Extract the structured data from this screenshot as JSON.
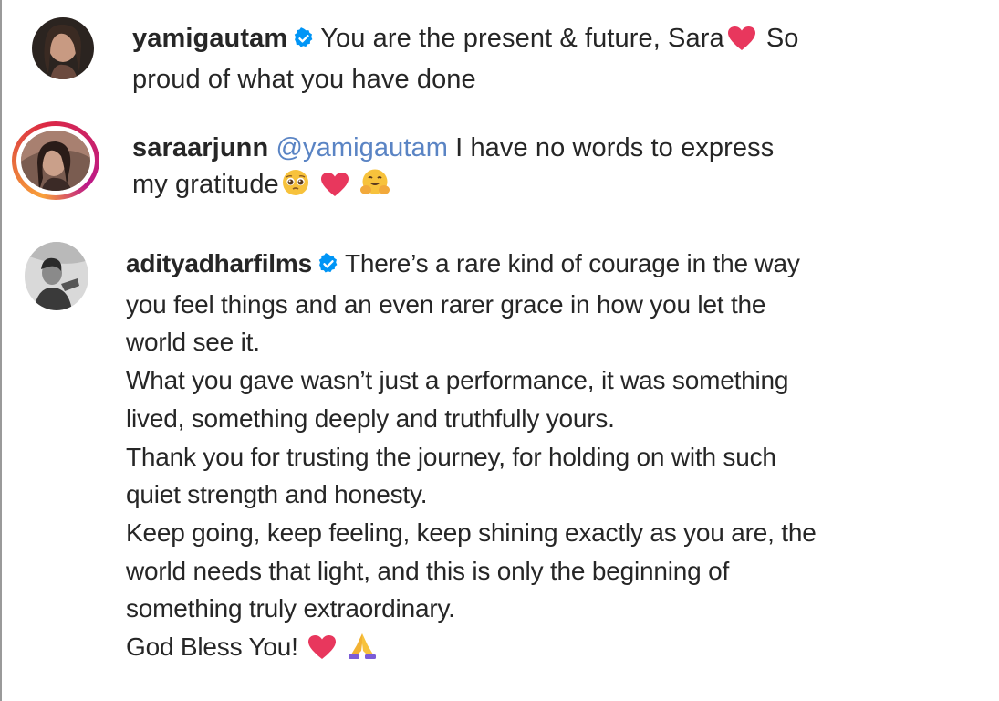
{
  "comments": [
    {
      "username": "yamigautam",
      "verified": true,
      "lines": [
        "You are the present & future, Sara",
        "So",
        "proud of what you have done"
      ],
      "emoji": [
        "red-heart"
      ]
    },
    {
      "username": "saraarjunn",
      "verified": false,
      "has_story_ring": true,
      "mention": "@yamigautam",
      "lines": [
        "I have no words to express",
        "my gratitude"
      ],
      "emoji": [
        "pleading-face",
        "red-heart",
        "hugging-face"
      ]
    },
    {
      "username": "adityadharfilms",
      "verified": true,
      "lines": [
        "There’s a rare kind of courage in the way",
        "you feel things and an even rarer grace in how you let the",
        "world see it.",
        "What you gave wasn’t just a performance, it was something",
        "lived, something deeply and truthfully yours.",
        "Thank you for trusting the journey, for holding on with such",
        "quiet strength and honesty.",
        "Keep going, keep feeling, keep shining exactly as you are, the",
        "world needs that light, and this is only the beginning of",
        "something truly extraordinary.",
        "God Bless You!"
      ],
      "emoji": [
        "red-heart",
        "folded-hands"
      ]
    }
  ],
  "colors": {
    "text": "#262626",
    "mention": "#5a84c4",
    "verified": "#0095f6",
    "heart": "#e8375d"
  }
}
